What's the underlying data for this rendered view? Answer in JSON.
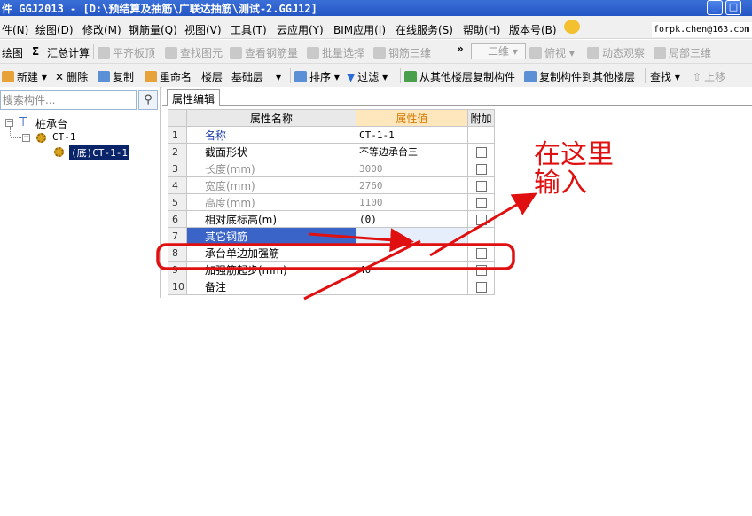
{
  "window": {
    "title": "件 GGJ2013 - [D:\\预结算及抽筋\\广联达抽筋\\测试-2.GGJ12]",
    "minimize_glyph": "_",
    "close_glyph": "□"
  },
  "menu": {
    "items": [
      "件(N)",
      "绘图(D)",
      "修改(M)",
      "钢筋量(Q)",
      "视图(V)",
      "工具(T)",
      "云应用(Y)",
      "BIM应用(I)",
      "在线服务(S)",
      "帮助(H)",
      "版本号(B)"
    ],
    "email": "forpk.chen@163.com"
  },
  "toolbar1": {
    "draw": "绘图",
    "sum_glyph": "Σ",
    "sum_calc": "汇总计算",
    "flat_slab": "平齐板顶",
    "find_element": "查找图元",
    "view_rebar": "查看钢筋量",
    "batch_select": "批量选择",
    "rebar_3d": "钢筋三维",
    "more": "»",
    "view_2d": "二维",
    "top_view": "俯视",
    "dynamic_view": "动态观察",
    "local_3d": "局部三维"
  },
  "toolbar2": {
    "new": "新建",
    "delete": "删除",
    "copy": "复制",
    "rename": "重命名",
    "floor_label": "楼层",
    "floor_value": "基础层",
    "sort": "排序",
    "filter": "过滤",
    "copy_from_floor": "从其他楼层复制构件",
    "copy_to_floor": "复制构件到其他楼层",
    "find": "查找",
    "move_up": "上移"
  },
  "left_panel": {
    "search_placeholder": "搜索构件...",
    "search_icon": "search-icon",
    "tree": {
      "root": "桩承台",
      "child": "CT-1",
      "leaf": "(底)CT-1-1"
    }
  },
  "right_panel": {
    "tab": "属性编辑",
    "columns": {
      "name": "属性名称",
      "value": "属性值",
      "extra": "附加"
    },
    "rows": [
      {
        "num": "1",
        "name": "名称",
        "value": "CT-1-1"
      },
      {
        "num": "2",
        "name": "截面形状",
        "value": "不等边承台三"
      },
      {
        "num": "3",
        "name": "长度(mm)",
        "value": "3000"
      },
      {
        "num": "4",
        "name": "宽度(mm)",
        "value": "2760"
      },
      {
        "num": "5",
        "name": "高度(mm)",
        "value": "1100"
      },
      {
        "num": "6",
        "name": "相对底标高(m)",
        "value": "(0)"
      },
      {
        "num": "7",
        "name": "其它钢筋",
        "value": ""
      },
      {
        "num": "8",
        "name": "承台单边加强筋",
        "value": ""
      },
      {
        "num": "9",
        "name": "加强筋起步(mm)",
        "value": "40"
      },
      {
        "num": "10",
        "name": "备注",
        "value": ""
      }
    ]
  },
  "annotation": {
    "line1": "在这里",
    "line2": "输入",
    "color": "#e01010"
  }
}
